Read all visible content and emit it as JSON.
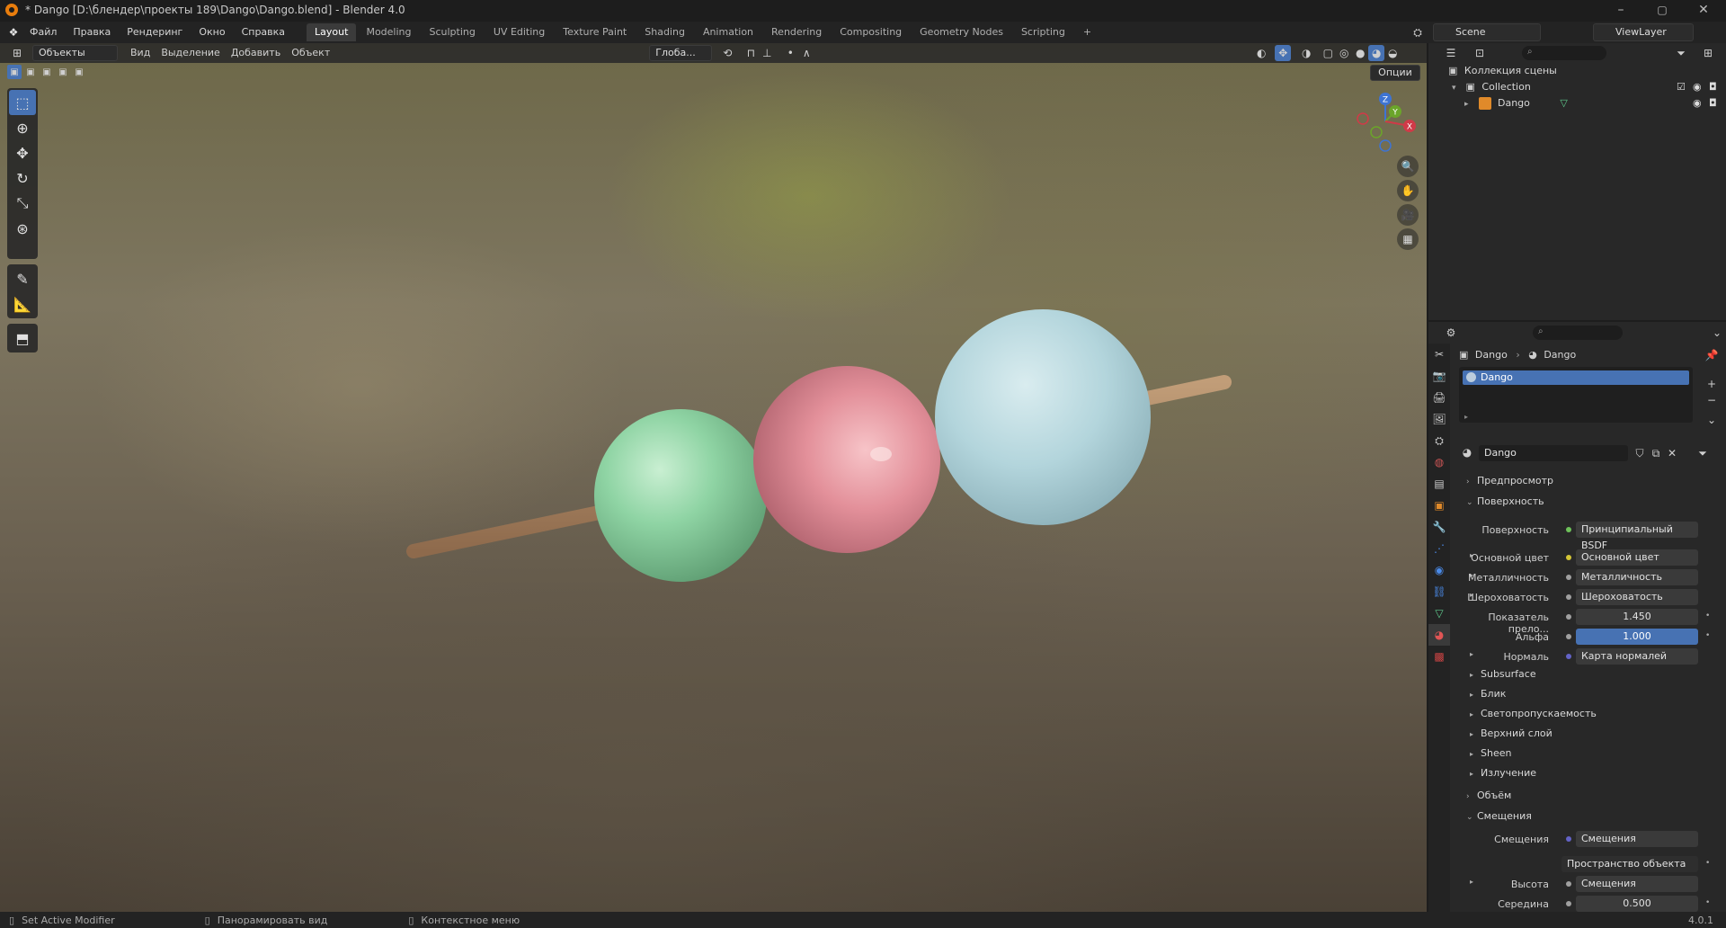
{
  "window": {
    "title": "* Dango [D:\\блендер\\проекты 189\\Dango\\Dango.blend] - Blender 4.0",
    "minimize": "–",
    "maximize": "▢",
    "close": "✕"
  },
  "menu": [
    "Файл",
    "Правка",
    "Рендеринг",
    "Окно",
    "Справка"
  ],
  "workspaces": [
    "Layout",
    "Modeling",
    "Sculpting",
    "UV Editing",
    "Texture Paint",
    "Shading",
    "Animation",
    "Rendering",
    "Compositing",
    "Geometry Nodes",
    "Scripting"
  ],
  "workspace_add": "+",
  "scene": {
    "scene_name": "Scene",
    "view_layer": "ViewLayer"
  },
  "viewport_header": {
    "mode": "Объекты",
    "menus": [
      "Вид",
      "Выделение",
      "Добавить",
      "Объект"
    ],
    "transform_orientation": "Глоба...",
    "options": "Опции"
  },
  "gizmo": {
    "z": "Z",
    "y": "Y",
    "x": "X"
  },
  "outliner": {
    "root": "Коллекция сцены",
    "collection": "Collection",
    "object": "Dango"
  },
  "properties": {
    "breadcrumb_object": "Dango",
    "breadcrumb_material": "Dango",
    "slot_name": "Dango",
    "material_name": "Dango",
    "sections": {
      "preview": "Предпросмотр",
      "surface": "Поверхность",
      "volume": "Объём",
      "displacement": "Смещения"
    },
    "surface_rows": [
      {
        "label": "Поверхность",
        "value": "Принципиальный BSDF",
        "dot": "#6ec25a"
      },
      {
        "label": "Основной цвет",
        "value": "Основной цвет",
        "dot": "#d4c636"
      },
      {
        "label": "Металличность",
        "value": "Металличность",
        "dot": "#a0a0a0"
      },
      {
        "label": "Шероховатость",
        "value": "Шероховатость",
        "dot": "#a0a0a0"
      },
      {
        "label": "Показатель прело...",
        "value": "1.450",
        "dot": "#a0a0a0"
      },
      {
        "label": "Альфа",
        "value": "1.000",
        "dot": "#a0a0a0"
      },
      {
        "label": "Нормаль",
        "value": "Карта нормалей",
        "dot": "#6363c7"
      }
    ],
    "subsections": [
      "Subsurface",
      "Блик",
      "Светопропускаемость",
      "Верхний слой",
      "Sheen",
      "Излучение"
    ],
    "disp_rows": [
      {
        "label": "Смещения",
        "value": "Смещения",
        "dot": "#6363c7"
      },
      {
        "label": "",
        "value": "Пространство объекта",
        "dot": ""
      },
      {
        "label": "Высота",
        "value": "Смещения",
        "dot": "#a0a0a0"
      },
      {
        "label": "Середина",
        "value": "0.500",
        "dot": "#a0a0a0"
      }
    ]
  },
  "status": {
    "left": "Set Active Modifier",
    "middle": "Панорамировать вид",
    "right": "Контекстное меню",
    "version": "4.0.1"
  },
  "colors": {
    "accent": "#4772b3",
    "sphere_green": "#8fd4a4",
    "sphere_pink": "#e3909a",
    "sphere_blue": "#b3d5dc",
    "stick": "#a98462"
  }
}
